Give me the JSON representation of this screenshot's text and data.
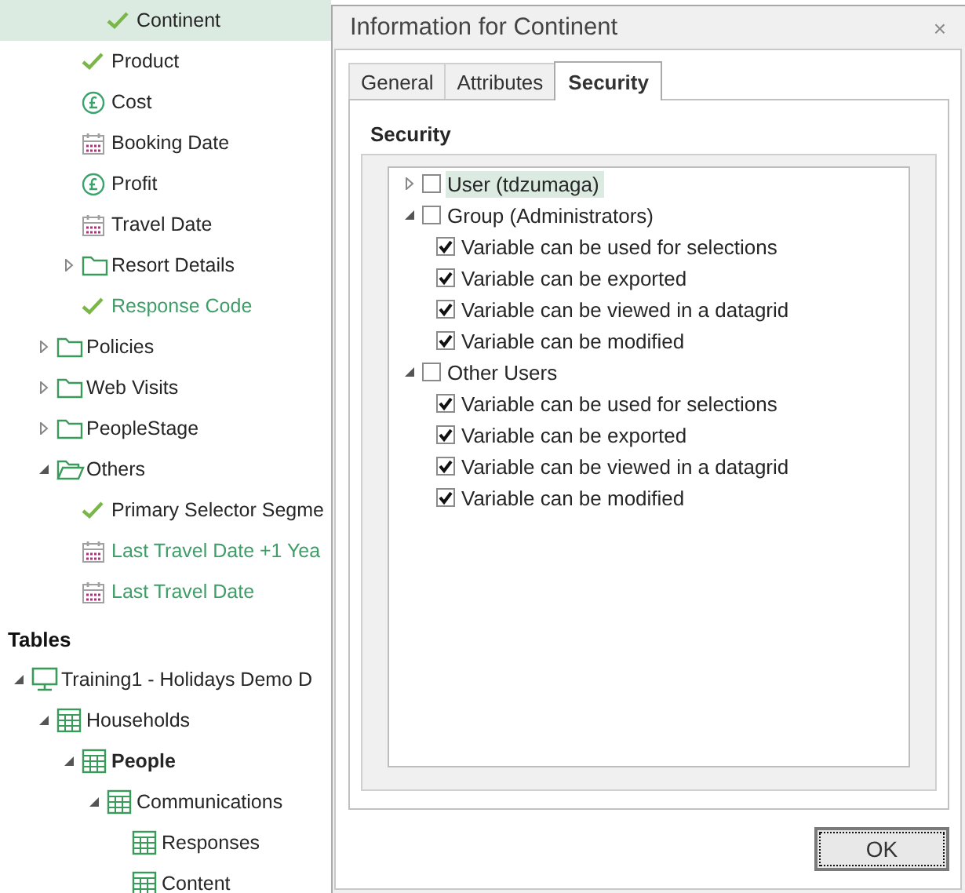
{
  "sidebar": {
    "deeper_rows": [
      {
        "label": "Continent",
        "kind": "check",
        "color": "#262626",
        "selected": true,
        "bold": false
      }
    ],
    "group_rows": [
      {
        "label": "Product",
        "kind": "check",
        "color": "#262626",
        "selected": false,
        "bold": false
      },
      {
        "label": "Cost",
        "kind": "currency",
        "color": "#262626",
        "selected": false,
        "bold": false
      },
      {
        "label": "Booking Date",
        "kind": "calendar",
        "color": "#262626",
        "selected": false,
        "bold": false
      },
      {
        "label": "Profit",
        "kind": "currency",
        "color": "#262626",
        "selected": false,
        "bold": false
      },
      {
        "label": "Travel Date",
        "kind": "calendar",
        "color": "#262626",
        "selected": false,
        "bold": false
      },
      {
        "label": "Resort Details",
        "kind": "folder",
        "color": "#262626",
        "selected": false,
        "bold": false,
        "expanded": false
      },
      {
        "label": "Response Code",
        "kind": "check",
        "color": "#3f9e68",
        "selected": false,
        "bold": false
      }
    ],
    "items": [
      {
        "label": "Policies",
        "kind": "folder",
        "color": "#262626",
        "selected": false,
        "bold": false,
        "expanded": false
      },
      {
        "label": "Web Visits",
        "kind": "folder",
        "color": "#262626",
        "selected": false,
        "bold": false,
        "expanded": false
      },
      {
        "label": "PeopleStage",
        "kind": "folder",
        "color": "#262626",
        "selected": false,
        "bold": false,
        "expanded": false
      },
      {
        "label": "Others",
        "kind": "folder",
        "color": "#262626",
        "selected": false,
        "bold": false,
        "expanded": true,
        "children": [
          {
            "label": "Primary Selector Segme",
            "kind": "check",
            "color": "#262626",
            "selected": false,
            "bold": false
          },
          {
            "label": "Last Travel Date +1 Yea",
            "kind": "calendar",
            "color": "#3f9e68",
            "selected": false,
            "bold": false
          },
          {
            "label": "Last Travel Date",
            "kind": "calendar",
            "color": "#3f9e68",
            "selected": false,
            "bold": false
          }
        ]
      }
    ],
    "tables_heading": "Tables",
    "tables": [
      {
        "label": "Training1 - Holidays Demo D",
        "kind": "database",
        "color": "#262626",
        "selected": false,
        "bold": false,
        "expanded": true,
        "children": [
          {
            "label": "Households",
            "kind": "table",
            "color": "#262626",
            "selected": false,
            "bold": false,
            "expanded": true,
            "children": [
              {
                "label": "People",
                "kind": "table",
                "color": "#262626",
                "selected": false,
                "bold": true,
                "expanded": true,
                "children": [
                  {
                    "label": "Communications",
                    "kind": "table",
                    "color": "#262626",
                    "selected": false,
                    "bold": false,
                    "expanded": true,
                    "children": [
                      {
                        "label": "Responses",
                        "kind": "table",
                        "color": "#262626",
                        "selected": false,
                        "bold": false
                      },
                      {
                        "label": "Content",
                        "kind": "table",
                        "color": "#262626",
                        "selected": false,
                        "bold": false
                      }
                    ]
                  }
                ]
              }
            ]
          }
        ]
      }
    ]
  },
  "dialog": {
    "title": "Information for Continent",
    "close": "×",
    "tabs": [
      {
        "label": "General",
        "selected": false
      },
      {
        "label": "Attributes",
        "selected": false
      },
      {
        "label": "Security",
        "selected": true
      }
    ],
    "heading": "Security",
    "permissions": [
      {
        "label": "User (tdzumaga)",
        "expanded": false,
        "checked": false,
        "selected": true
      },
      {
        "label": "Group (Administrators)",
        "expanded": true,
        "checked": false,
        "selected": false,
        "children": [
          {
            "label": "Variable can be used for selections",
            "checked": true,
            "selected": false
          },
          {
            "label": "Variable can be exported",
            "checked": true,
            "selected": false
          },
          {
            "label": "Variable can be viewed in a datagrid",
            "checked": true,
            "selected": false
          },
          {
            "label": "Variable can be modified",
            "checked": true,
            "selected": false
          }
        ]
      },
      {
        "label": "Other Users",
        "expanded": true,
        "checked": false,
        "selected": false,
        "children": [
          {
            "label": "Variable can be used for selections",
            "checked": true,
            "selected": false
          },
          {
            "label": "Variable can be exported",
            "checked": true,
            "selected": false
          },
          {
            "label": "Variable can be viewed in a datagrid",
            "checked": true,
            "selected": false
          },
          {
            "label": "Variable can be modified",
            "checked": true,
            "selected": false
          }
        ]
      }
    ],
    "buttons": [
      {
        "label": "OK",
        "default": true
      }
    ]
  }
}
